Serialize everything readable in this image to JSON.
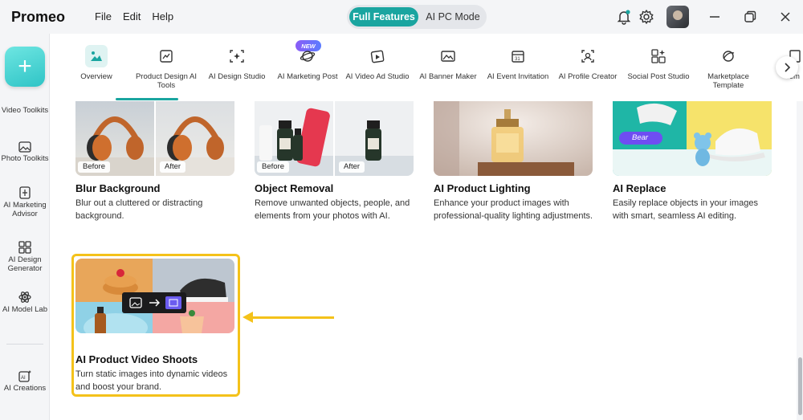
{
  "app": {
    "title": "Promeo",
    "menu": [
      "File",
      "Edit",
      "Help"
    ]
  },
  "mode_switch": {
    "active": "Full Features",
    "inactive": "AI PC Mode"
  },
  "sidebar": {
    "items": [
      {
        "label": "Video Toolkits",
        "icon": "video-icon"
      },
      {
        "label": "Photo Toolkits",
        "icon": "photo-icon"
      },
      {
        "label": "AI Marketing Advisor",
        "icon": "marketing-icon"
      },
      {
        "label": "AI Design Generator",
        "icon": "grid-icon"
      },
      {
        "label": "AI Model Lab",
        "icon": "atom-icon"
      },
      {
        "label": "AI Creations",
        "icon": "ai-creations-icon"
      }
    ]
  },
  "tabs": {
    "items": [
      {
        "label": "Overview",
        "active": true
      },
      {
        "label": "Product Design AI Tools"
      },
      {
        "label": "AI Design Studio"
      },
      {
        "label": "AI Marketing Post"
      },
      {
        "label": "AI Video Ad Studio"
      },
      {
        "label": "AI Banner Maker"
      },
      {
        "label": "AI Event Invitation"
      },
      {
        "label": "AI Profile Creator"
      },
      {
        "label": "Social Post Studio"
      },
      {
        "label": "Marketplace Template"
      },
      {
        "label": "Tem"
      }
    ],
    "new_badge": "NEW"
  },
  "cards": [
    {
      "title": "Blur Background",
      "desc": "Blur out a cluttered or distracting background.",
      "before": "Before",
      "after": "After"
    },
    {
      "title": "Object Removal",
      "desc": "Remove unwanted objects, people, and elements from your photos with AI.",
      "before": "Before",
      "after": "After"
    },
    {
      "title": "AI Product Lighting",
      "desc": "Enhance your product images with professional-quality lighting adjustments."
    },
    {
      "title": "AI Replace",
      "desc": "Easily replace objects in your images with smart, seamless AI editing.",
      "tag": "Bear"
    },
    {
      "title": "AI Product Video Shoots",
      "desc": "Turn static images into dynamic videos and boost your brand."
    }
  ],
  "colors": {
    "accent": "#1aa5a0",
    "highlight": "#f4c21a"
  }
}
